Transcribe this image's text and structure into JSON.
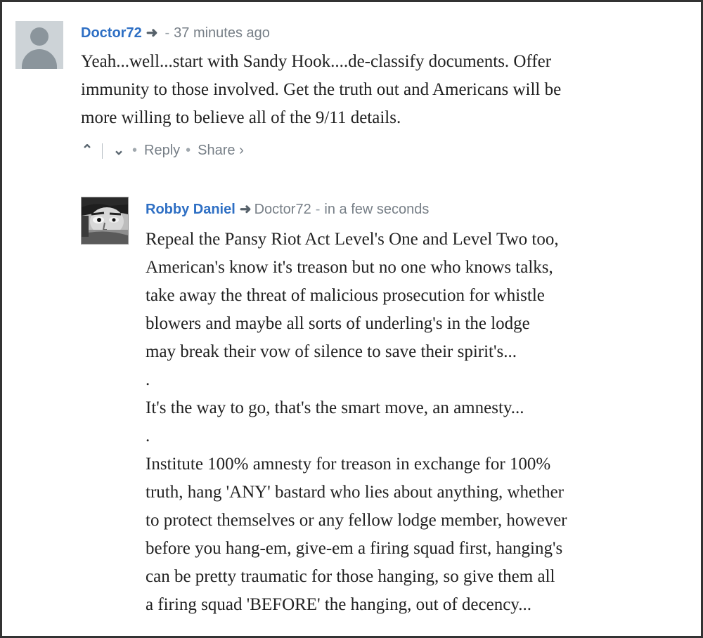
{
  "parent_comment": {
    "author": "Doctor72",
    "arrow_icon": "reply-arrow-icon",
    "separator": "-",
    "timestamp": "37 minutes ago",
    "lines": [
      "Yeah...well...start with Sandy Hook....de-classify documents. Offer",
      "immunity to those involved. Get the truth out and Americans will be",
      "more willing to believe all of the 9/11 details."
    ],
    "actions": {
      "upvote_icon": "upvote-icon",
      "downvote_icon": "downvote-icon",
      "dot": "•",
      "reply_label": "Reply",
      "share_label": "Share ›"
    }
  },
  "reply_comment": {
    "author": "Robby Daniel",
    "arrow_icon": "reply-arrow-icon",
    "in_reply_to": "Doctor72",
    "separator": "-",
    "timestamp": "in a few seconds",
    "lines": [
      "Repeal the Pansy Riot Act Level's One and Level Two too,",
      "American's know it's treason but no one who knows talks,",
      "take away the threat of malicious prosecution for whistle",
      "blowers and maybe all sorts of underling's in the lodge",
      "may break their vow of silence to save their spirit's...",
      ".",
      "It's the way to go, that's the smart move, an amnesty...",
      ".",
      "Institute 100% amnesty for treason in exchange for 100%",
      "truth, hang 'ANY' bastard who lies about anything, whether",
      "to protect themselves or any fellow lodge member, however",
      "before you hang-em, give-em a firing squad first, hanging's",
      "can be pretty traumatic for those hanging, so give them all",
      "a firing squad 'BEFORE' the hanging, out of decency..."
    ]
  },
  "colors": {
    "author_link": "#2e6fc4",
    "meta_text": "#777f87",
    "body_text": "#222222",
    "border": "#333333"
  }
}
